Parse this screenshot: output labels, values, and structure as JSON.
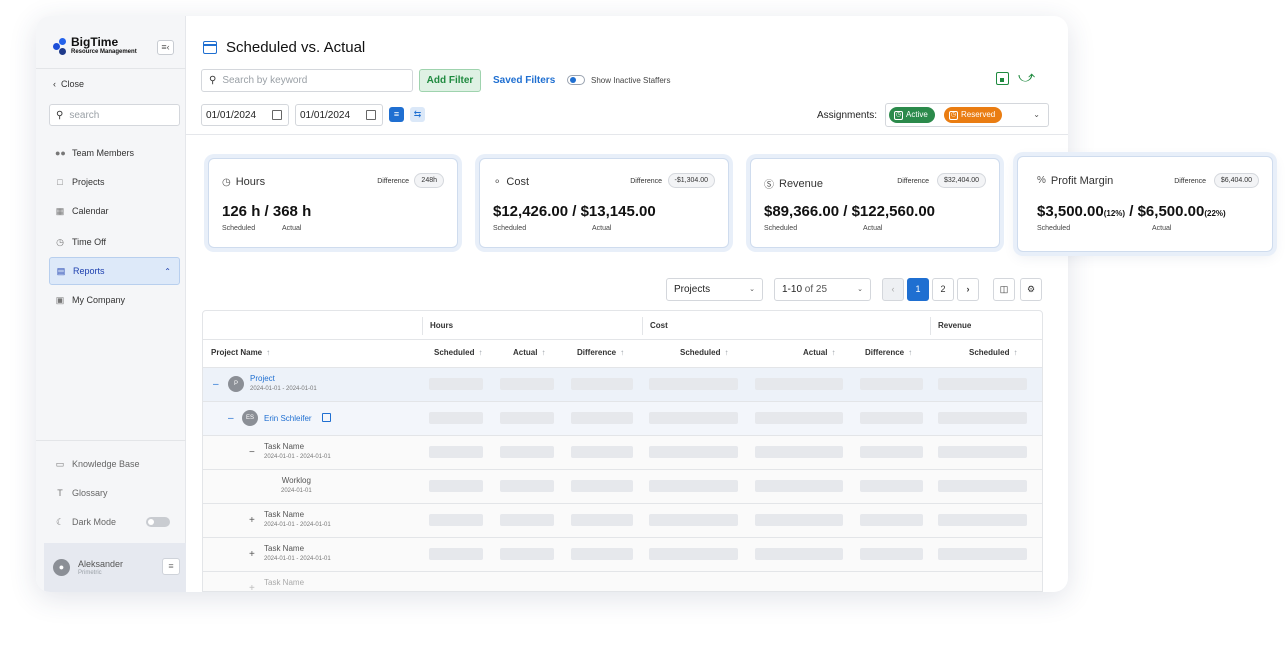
{
  "brand": {
    "name": "BigTime",
    "tagline": "Resource Management"
  },
  "sidebar": {
    "close_label": "Close",
    "search_placeholder": "search",
    "items": [
      {
        "label": "Team Members",
        "icon": "users-icon"
      },
      {
        "label": "Projects",
        "icon": "folder-icon"
      },
      {
        "label": "Calendar",
        "icon": "calendar-icon"
      },
      {
        "label": "Time Off",
        "icon": "stopwatch-icon"
      },
      {
        "label": "Reports",
        "icon": "report-icon"
      },
      {
        "label": "My Company",
        "icon": "building-icon"
      }
    ],
    "bottom_items": [
      {
        "label": "Knowledge Base",
        "icon": "book-icon"
      },
      {
        "label": "Glossary",
        "icon": "glossary-icon"
      },
      {
        "label": "Dark Mode",
        "icon": "moon-icon"
      }
    ],
    "user": {
      "name": "Aleksander",
      "org": "Primetric"
    }
  },
  "header": {
    "title": "Scheduled vs. Actual",
    "search_placeholder": "Search by keyword",
    "add_filter": "Add Filter",
    "saved_filters": "Saved Filters",
    "show_inactive": "Show Inactive Staffers",
    "date_from": "01/01/2024",
    "date_to": "01/01/2024",
    "assignments_label": "Assignments:",
    "assignment_active": "Active",
    "assignment_reserved": "Reserved",
    "colors": {
      "active": "#2b8a4b",
      "reserved": "#ea7d12",
      "accent": "#1f6fd1"
    }
  },
  "kpis": [
    {
      "title": "Hours",
      "icon": "clock-icon",
      "diff_label": "Difference",
      "diff": "248h",
      "scheduled": "126 h",
      "actual": "368 h",
      "scheduled_pct": "",
      "actual_pct": "",
      "scheduled_lbl": "Scheduled",
      "actual_lbl": "Actual"
    },
    {
      "title": "Cost",
      "icon": "coins-icon",
      "diff_label": "Difference",
      "diff": "-$1,304.00",
      "scheduled": "$12,426.00",
      "actual": "$13,145.00",
      "scheduled_pct": "",
      "actual_pct": "",
      "scheduled_lbl": "Scheduled",
      "actual_lbl": "Actual"
    },
    {
      "title": "Revenue",
      "icon": "dollar-icon",
      "diff_label": "Difference",
      "diff": "$32,404.00",
      "scheduled": "$89,366.00",
      "actual": "$122,560.00",
      "scheduled_pct": "",
      "actual_pct": "",
      "scheduled_lbl": "Scheduled",
      "actual_lbl": "Actual"
    },
    {
      "title": "Profit Margin",
      "icon": "percent-icon",
      "diff_label": "Difference",
      "diff": "$6,404.00",
      "scheduled": "$3,500.00",
      "actual": "$6,500.00",
      "scheduled_pct": "(12%)",
      "actual_pct": "(22%)",
      "scheduled_lbl": "Scheduled",
      "actual_lbl": "Actual"
    }
  ],
  "table_toolbar": {
    "group_by": "Projects",
    "range": "1-10",
    "range_of": "of 25",
    "pages": [
      "1",
      "2"
    ]
  },
  "table": {
    "groups": [
      "Hours",
      "Cost",
      "Revenue"
    ],
    "columns": [
      "Project Name",
      "Scheduled",
      "Actual",
      "Difference",
      "Scheduled",
      "Actual",
      "Difference",
      "Scheduled"
    ],
    "rows": [
      {
        "kind": "project",
        "name": "Project",
        "date": "2024-01-01 - 2024-01-01",
        "badge": "P"
      },
      {
        "kind": "employee",
        "name": "Erin Schleifer",
        "initials": "ES"
      },
      {
        "kind": "task",
        "name": "Task Name",
        "date": "2024-01-01 - 2024-01-01",
        "sign": "−"
      },
      {
        "kind": "worklog",
        "name": "Worklog",
        "date": "2024-01-01"
      },
      {
        "kind": "task",
        "name": "Task Name",
        "date": "2024-01-01 - 2024-01-01",
        "sign": "+"
      },
      {
        "kind": "task",
        "name": "Task Name",
        "date": "2024-01-01 - 2024-01-01",
        "sign": "+"
      },
      {
        "kind": "task",
        "name": "Task Name",
        "date": "",
        "sign": "+"
      }
    ]
  }
}
